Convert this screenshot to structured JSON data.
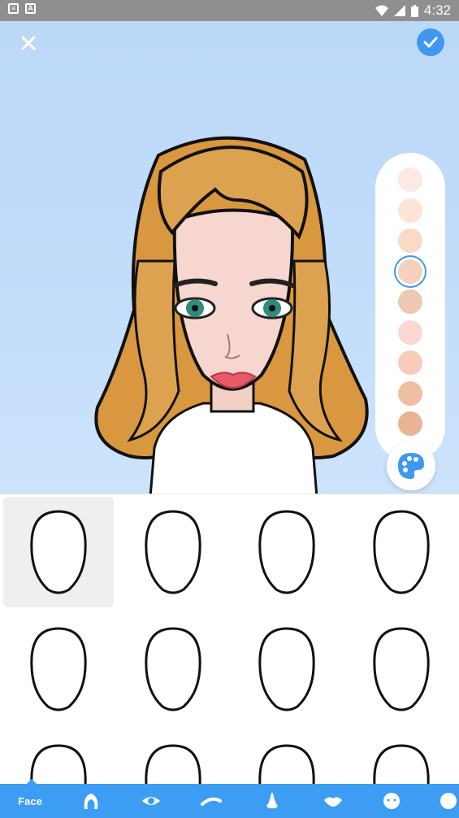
{
  "status_bar": {
    "time": "4:32"
  },
  "palette": {
    "swatches": [
      "#fde9e1",
      "#fde4d6",
      "#fbd9c7",
      "#f6d1bf",
      "#efc8b2",
      "#fad7d0",
      "#f8cbbb",
      "#efbfa3",
      "#e8b495"
    ],
    "selected_index": 3
  },
  "face_grid": {
    "selected_index": 0,
    "rows": 3,
    "cols": 4
  },
  "bottom_nav": {
    "face_label": "Face",
    "items": [
      "hair-icon",
      "eye-icon",
      "eyebrow-icon",
      "nose-icon",
      "lips-icon",
      "head-icon",
      "more-icon"
    ]
  },
  "colors": {
    "accent": "#3e98f0",
    "nav_bg": "#3d9df3",
    "hair": "#dda24f",
    "skin": "#f6d6ce"
  }
}
